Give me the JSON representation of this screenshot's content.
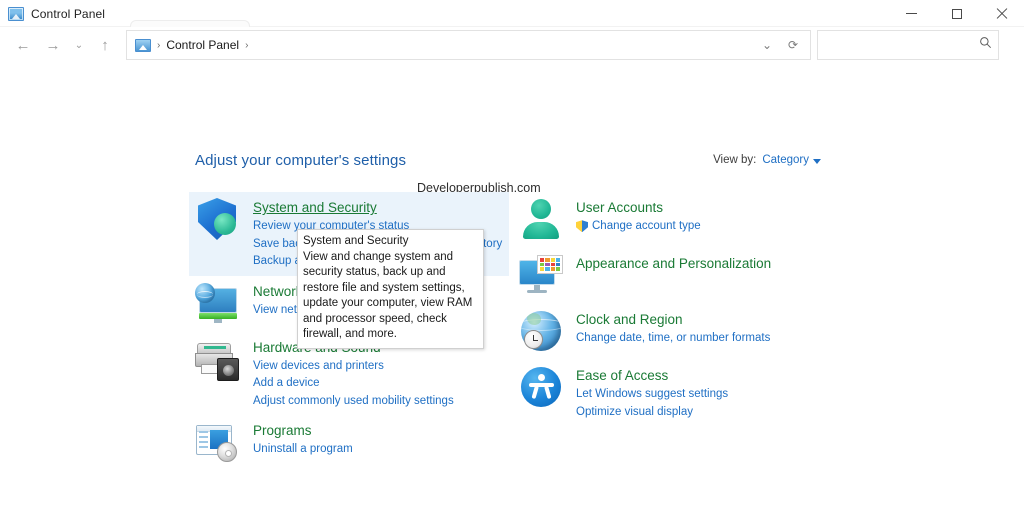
{
  "window": {
    "title": "Control Panel",
    "app_icon": "control-panel-icon",
    "controls": {
      "minimize": "Minimize",
      "maximize": "Maximize",
      "close": "Close"
    }
  },
  "navbar": {
    "back": "Back",
    "forward": "Forward",
    "recent": "Recent locations",
    "up": "Up",
    "refresh": "Refresh",
    "dropdown": "Previous locations",
    "breadcrumb": {
      "icon": "control-panel-icon",
      "items": [
        "Control Panel"
      ],
      "separator": "›"
    },
    "search": {
      "value": "",
      "placeholder": "",
      "icon": "search-icon"
    }
  },
  "main": {
    "page_title": "Adjust your computer's settings",
    "watermark": "Developerpublish.com",
    "view_by": {
      "label": "View by:",
      "value": "Category"
    },
    "left_column": [
      {
        "icon": "shield-icon",
        "title": "System and Security",
        "hovered": true,
        "links": [
          {
            "text": "Review your computer's status",
            "shield": false
          },
          {
            "text": "Save backup copies of your files with File History",
            "shield": false
          },
          {
            "text": "Backup and Restore (Windows 7)",
            "shield": false
          }
        ]
      },
      {
        "icon": "network-icon",
        "title": "Network and Internet",
        "hovered": false,
        "links": [
          {
            "text": "View network status and tasks",
            "shield": false
          }
        ]
      },
      {
        "icon": "printer-speaker-icon",
        "title": "Hardware and Sound",
        "hovered": false,
        "links": [
          {
            "text": "View devices and printers",
            "shield": false
          },
          {
            "text": "Add a device",
            "shield": false
          },
          {
            "text": "Adjust commonly used mobility settings",
            "shield": false
          }
        ]
      },
      {
        "icon": "programs-icon",
        "title": "Programs",
        "hovered": false,
        "links": [
          {
            "text": "Uninstall a program",
            "shield": false
          }
        ]
      }
    ],
    "right_column": [
      {
        "icon": "user-icon",
        "title": "User Accounts",
        "hovered": false,
        "links": [
          {
            "text": "Change account type",
            "shield": true
          }
        ]
      },
      {
        "icon": "appearance-icon",
        "title": "Appearance and Personalization",
        "hovered": false,
        "links": []
      },
      {
        "icon": "clock-globe-icon",
        "title": "Clock and Region",
        "hovered": false,
        "links": [
          {
            "text": "Change date, time, or number formats",
            "shield": false
          }
        ]
      },
      {
        "icon": "ease-of-access-icon",
        "title": "Ease of Access",
        "hovered": false,
        "links": [
          {
            "text": "Let Windows suggest settings",
            "shield": false
          },
          {
            "text": "Optimize visual display",
            "shield": false
          }
        ]
      }
    ]
  },
  "tooltip": {
    "title": "System and Security",
    "body": "View and change system and security status, back up and restore file and system settings, update your computer, view RAM and processor speed, check firewall, and more."
  },
  "colors": {
    "link": "#1f6fc4",
    "category_title": "#1a7a35",
    "page_title": "#1f5fa9",
    "hover_background": "#eaf3fb",
    "window_background": "#ffffff"
  }
}
